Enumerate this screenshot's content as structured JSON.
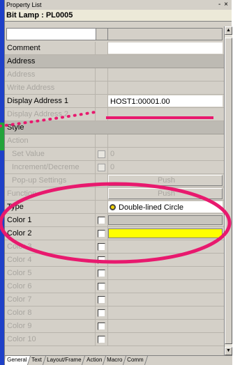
{
  "window": {
    "title": "Property List",
    "pin_close": "- ×",
    "object_name": "Bit Lamp : PL0005"
  },
  "rows": {
    "comment": {
      "label": "Comment",
      "value": ""
    },
    "address_section": "Address",
    "address": "Address",
    "write_address": "Write Address",
    "display_address_1": {
      "label": "Display Address 1",
      "value": "HOST1:00001.00"
    },
    "display_address_2": "Display Address 2",
    "style_section": "Style",
    "action": "Action",
    "set_value": {
      "label": "Set Value",
      "value": "0"
    },
    "increment": {
      "label": "Increment/Decreme",
      "value": "0"
    },
    "popup": {
      "label": "Pop-up Settings",
      "value": "Push"
    },
    "function": {
      "label": "Function",
      "value": "Push"
    },
    "type": {
      "label": "Type",
      "value": "Double-lined Circle"
    },
    "color1": "Color 1",
    "color2": "Color 2",
    "color3": "Color 3",
    "color4": "Color 4",
    "color5": "Color 5",
    "color6": "Color 6",
    "color7": "Color 7",
    "color8": "Color 8",
    "color9": "Color 9",
    "color10": "Color 10"
  },
  "tabs": [
    "General",
    "Text",
    "Layout/Frame",
    "Action",
    "Macro",
    "Comm"
  ],
  "colors": {
    "color1_swatch": "#c8c5be",
    "color2_swatch": "#ffff00",
    "annotation": "#e8196e"
  },
  "scroll": {
    "up": "▲",
    "down": "▼"
  }
}
